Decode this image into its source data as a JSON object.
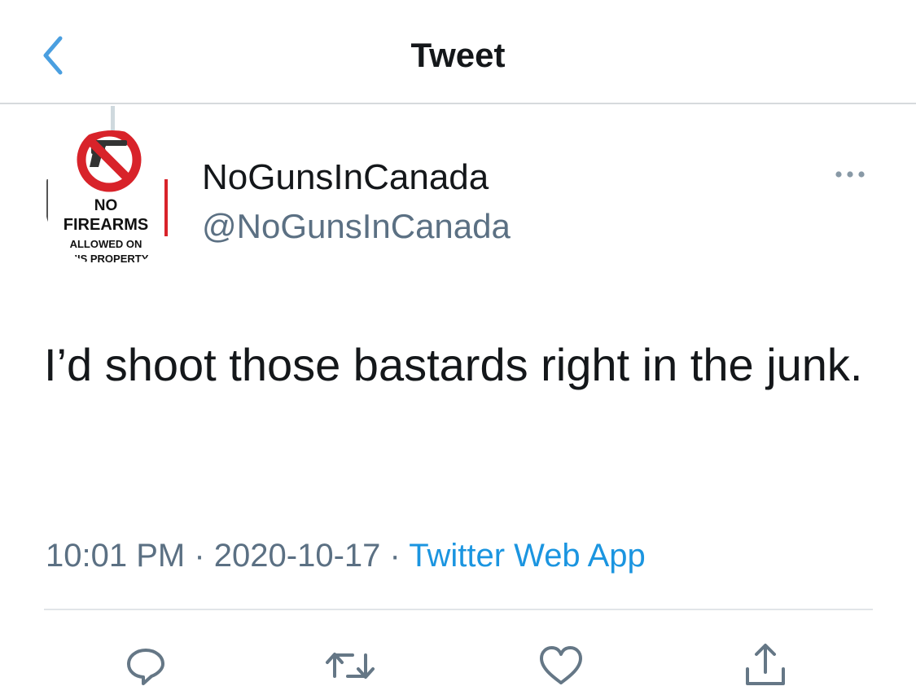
{
  "header": {
    "title": "Tweet",
    "back_icon": "chevron-left-icon"
  },
  "tweet": {
    "author": {
      "display_name": "NoGunsInCanada",
      "handle": "@NoGunsInCanada",
      "avatar_sign": {
        "line1": "NO",
        "line2": "FIREARMS",
        "line3": "ALLOWED ON",
        "line4": "THIS PROPERTY"
      }
    },
    "text": "I’d shoot those bastards right in the junk.",
    "time": "10:01 PM",
    "separator": "·",
    "date": "2020-10-17",
    "source": "Twitter Web App"
  },
  "actions": [
    {
      "name": "reply",
      "icon": "reply-icon"
    },
    {
      "name": "retweet",
      "icon": "retweet-icon"
    },
    {
      "name": "like",
      "icon": "heart-icon"
    },
    {
      "name": "share",
      "icon": "share-icon"
    }
  ],
  "colors": {
    "accent": "#1b95e0",
    "back_chevron": "#4a9fe0",
    "secondary_text": "#5b7083",
    "primary_text": "#14171a",
    "icon_gray": "#657786",
    "divider": "#e1e5e8",
    "sign_red": "#d8232a"
  }
}
